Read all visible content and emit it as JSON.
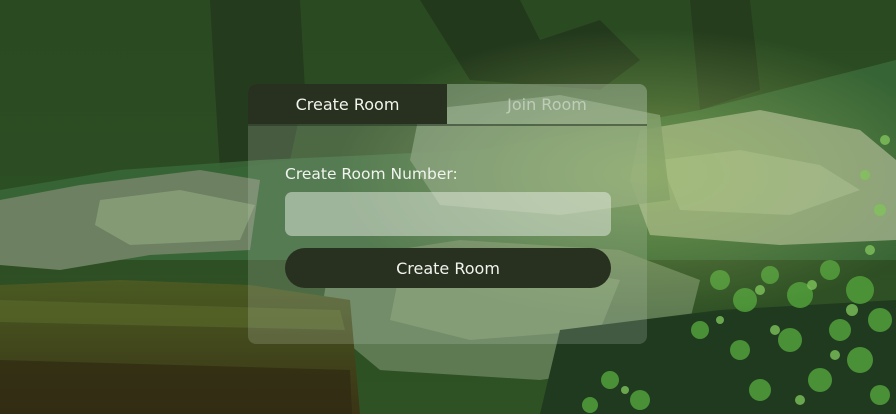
{
  "tabs": {
    "create_label": "Create Room",
    "join_label": "Join Room",
    "active": "create"
  },
  "form": {
    "label": "Create Room Number:",
    "input_value": "",
    "input_placeholder": "",
    "submit_label": "Create Room"
  },
  "colors": {
    "button_bg": "#28311f",
    "button_text": "#f2f4ee",
    "panel_tint": "rgba(190,205,185,0.22)"
  }
}
